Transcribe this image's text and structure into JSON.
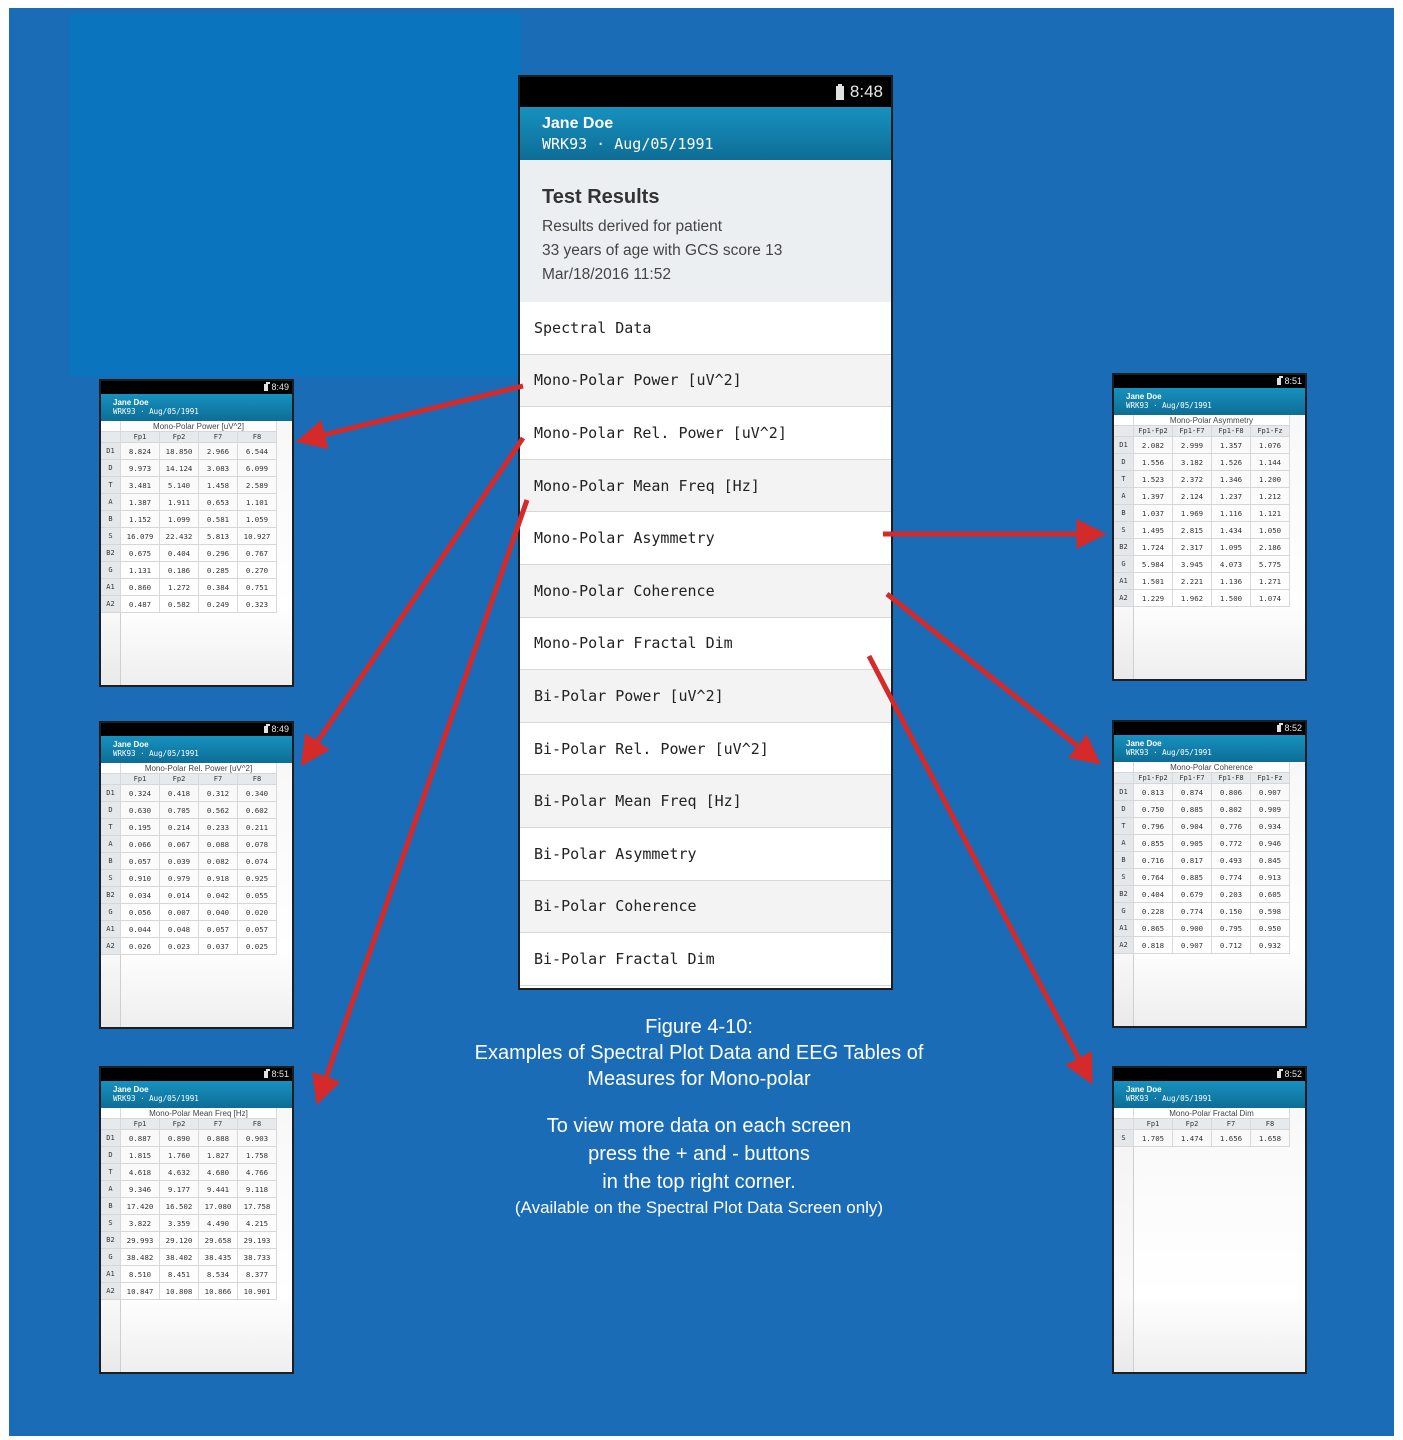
{
  "patient": {
    "name": "Jane Doe",
    "info": "WRK93 · Aug/05/1991"
  },
  "main_screen": {
    "time": "8:48",
    "results_title": "Test Results",
    "results_lines": [
      "Results derived for patient",
      "33 years of age with GCS score 13",
      "Mar/18/2016 11:52"
    ],
    "menu": [
      "Spectral Data",
      "Mono-Polar Power [uV^2]",
      "Mono-Polar Rel. Power [uV^2]",
      "Mono-Polar Mean Freq [Hz]",
      "Mono-Polar Asymmetry",
      "Mono-Polar Coherence",
      "Mono-Polar Fractal Dim",
      "Bi-Polar Power [uV^2]",
      "Bi-Polar Rel. Power [uV^2]",
      "Bi-Polar Mean Freq [Hz]",
      "Bi-Polar Asymmetry",
      "Bi-Polar Coherence",
      "Bi-Polar Fractal Dim"
    ]
  },
  "caption": {
    "figure": "Figure 4-10:",
    "line1": "Examples of Spectral Plot Data and EEG Tables of",
    "line2": "Measures for Mono-polar",
    "tip1": "To view more data on each screen",
    "tip2": "press the + and - buttons",
    "tip3": "in the top right corner.",
    "note": "(Available on the Spectral Plot Data Screen only)"
  },
  "tables": [
    {
      "id": "mono-power",
      "time": "8:49",
      "title": "Mono-Polar Power [uV^2]",
      "columns": [
        "Fp1",
        "Fp2",
        "F7",
        "F8"
      ],
      "rows": [
        {
          "label": "D1",
          "values": [
            "8.824",
            "18.850",
            "2.966",
            "6.544"
          ]
        },
        {
          "label": "D",
          "values": [
            "9.973",
            "14.124",
            "3.083",
            "6.099"
          ]
        },
        {
          "label": "T",
          "values": [
            "3.481",
            "5.140",
            "1.458",
            "2.589"
          ]
        },
        {
          "label": "A",
          "values": [
            "1.387",
            "1.911",
            "0.653",
            "1.101"
          ]
        },
        {
          "label": "B",
          "values": [
            "1.152",
            "1.099",
            "0.581",
            "1.059"
          ]
        },
        {
          "label": "S",
          "values": [
            "16.079",
            "22.432",
            "5.813",
            "10.927"
          ]
        },
        {
          "label": "B2",
          "values": [
            "0.675",
            "0.404",
            "0.296",
            "0.767"
          ]
        },
        {
          "label": "G",
          "values": [
            "1.131",
            "0.186",
            "0.285",
            "0.270"
          ]
        },
        {
          "label": "A1",
          "values": [
            "0.860",
            "1.272",
            "0.384",
            "0.751"
          ]
        },
        {
          "label": "A2",
          "values": [
            "0.487",
            "0.582",
            "0.249",
            "0.323"
          ]
        }
      ]
    },
    {
      "id": "mono-rel-power",
      "time": "8:49",
      "title": "Mono-Polar Rel. Power [uV^2]",
      "columns": [
        "Fp1",
        "Fp2",
        "F7",
        "F8"
      ],
      "rows": [
        {
          "label": "D1",
          "values": [
            "0.324",
            "0.418",
            "0.312",
            "0.340"
          ]
        },
        {
          "label": "D",
          "values": [
            "0.630",
            "0.705",
            "0.562",
            "0.602"
          ]
        },
        {
          "label": "T",
          "values": [
            "0.195",
            "0.214",
            "0.233",
            "0.211"
          ]
        },
        {
          "label": "A",
          "values": [
            "0.066",
            "0.067",
            "0.088",
            "0.078"
          ]
        },
        {
          "label": "B",
          "values": [
            "0.057",
            "0.039",
            "0.082",
            "0.074"
          ]
        },
        {
          "label": "S",
          "values": [
            "0.910",
            "0.979",
            "0.918",
            "0.925"
          ]
        },
        {
          "label": "B2",
          "values": [
            "0.034",
            "0.014",
            "0.042",
            "0.055"
          ]
        },
        {
          "label": "G",
          "values": [
            "0.056",
            "0.007",
            "0.040",
            "0.020"
          ]
        },
        {
          "label": "A1",
          "values": [
            "0.044",
            "0.048",
            "0.057",
            "0.057"
          ]
        },
        {
          "label": "A2",
          "values": [
            "0.026",
            "0.023",
            "0.037",
            "0.025"
          ]
        }
      ]
    },
    {
      "id": "mono-mean-freq",
      "time": "8:51",
      "title": "Mono-Polar Mean Freq [Hz]",
      "columns": [
        "Fp1",
        "Fp2",
        "F7",
        "F8"
      ],
      "rows": [
        {
          "label": "D1",
          "values": [
            "0.887",
            "0.890",
            "0.888",
            "0.903"
          ]
        },
        {
          "label": "D",
          "values": [
            "1.815",
            "1.760",
            "1.827",
            "1.758"
          ]
        },
        {
          "label": "T",
          "values": [
            "4.618",
            "4.632",
            "4.680",
            "4.766"
          ]
        },
        {
          "label": "A",
          "values": [
            "9.346",
            "9.177",
            "9.441",
            "9.118"
          ]
        },
        {
          "label": "B",
          "values": [
            "17.420",
            "16.502",
            "17.080",
            "17.758"
          ]
        },
        {
          "label": "S",
          "values": [
            "3.822",
            "3.359",
            "4.490",
            "4.215"
          ]
        },
        {
          "label": "B2",
          "values": [
            "29.993",
            "29.120",
            "29.658",
            "29.193"
          ]
        },
        {
          "label": "G",
          "values": [
            "38.482",
            "38.402",
            "38.435",
            "38.733"
          ]
        },
        {
          "label": "A1",
          "values": [
            "8.510",
            "8.451",
            "8.534",
            "8.377"
          ]
        },
        {
          "label": "A2",
          "values": [
            "10.847",
            "10.808",
            "10.866",
            "10.901"
          ]
        }
      ]
    },
    {
      "id": "mono-asymmetry",
      "time": "8:51",
      "title": "Mono-Polar Asymmetry",
      "columns": [
        "Fp1-Fp2",
        "Fp1-F7",
        "Fp1-F8",
        "Fp1-Fz"
      ],
      "rows": [
        {
          "label": "D1",
          "values": [
            "2.082",
            "2.999",
            "1.357",
            "1.076"
          ]
        },
        {
          "label": "D",
          "values": [
            "1.556",
            "3.182",
            "1.526",
            "1.144"
          ]
        },
        {
          "label": "T",
          "values": [
            "1.523",
            "2.372",
            "1.346",
            "1.200"
          ]
        },
        {
          "label": "A",
          "values": [
            "1.397",
            "2.124",
            "1.237",
            "1.212"
          ]
        },
        {
          "label": "B",
          "values": [
            "1.037",
            "1.969",
            "1.116",
            "1.121"
          ]
        },
        {
          "label": "S",
          "values": [
            "1.495",
            "2.815",
            "1.434",
            "1.050"
          ]
        },
        {
          "label": "B2",
          "values": [
            "1.724",
            "2.317",
            "1.095",
            "2.186"
          ]
        },
        {
          "label": "G",
          "values": [
            "5.984",
            "3.945",
            "4.073",
            "5.775"
          ]
        },
        {
          "label": "A1",
          "values": [
            "1.501",
            "2.221",
            "1.136",
            "1.271"
          ]
        },
        {
          "label": "A2",
          "values": [
            "1.229",
            "1.962",
            "1.500",
            "1.074"
          ]
        }
      ]
    },
    {
      "id": "mono-coherence",
      "time": "8:52",
      "title": "Mono-Polar Coherence",
      "columns": [
        "Fp1-Fp2",
        "Fp1-F7",
        "Fp1-F8",
        "Fp1-Fz"
      ],
      "rows": [
        {
          "label": "D1",
          "values": [
            "0.813",
            "0.874",
            "0.806",
            "0.907"
          ]
        },
        {
          "label": "D",
          "values": [
            "0.750",
            "0.885",
            "0.802",
            "0.909"
          ]
        },
        {
          "label": "T",
          "values": [
            "0.796",
            "0.904",
            "0.776",
            "0.934"
          ]
        },
        {
          "label": "A",
          "values": [
            "0.855",
            "0.905",
            "0.772",
            "0.946"
          ]
        },
        {
          "label": "B",
          "values": [
            "0.716",
            "0.817",
            "0.493",
            "0.845"
          ]
        },
        {
          "label": "S",
          "values": [
            "0.764",
            "0.885",
            "0.774",
            "0.913"
          ]
        },
        {
          "label": "B2",
          "values": [
            "0.404",
            "0.679",
            "0.203",
            "0.605"
          ]
        },
        {
          "label": "G",
          "values": [
            "0.228",
            "0.774",
            "0.150",
            "0.598"
          ]
        },
        {
          "label": "A1",
          "values": [
            "0.865",
            "0.900",
            "0.795",
            "0.950"
          ]
        },
        {
          "label": "A2",
          "values": [
            "0.818",
            "0.907",
            "0.712",
            "0.932"
          ]
        }
      ]
    },
    {
      "id": "mono-fractal",
      "time": "8:52",
      "title": "Mono-Polar Fractal Dim",
      "columns": [
        "Fp1",
        "Fp2",
        "F7",
        "F8"
      ],
      "rows": [
        {
          "label": "S",
          "values": [
            "1.705",
            "1.474",
            "1.656",
            "1.658"
          ]
        }
      ]
    }
  ]
}
